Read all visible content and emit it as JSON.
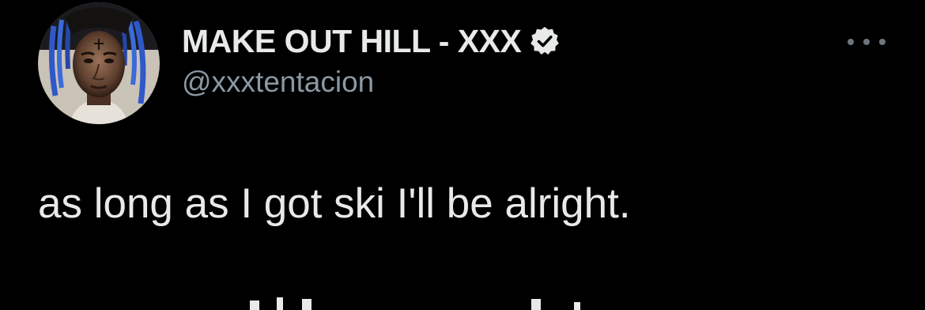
{
  "author": {
    "display_name": "MAKE OUT HILL - XXX",
    "handle": "@xxxtentacion",
    "verified": true
  },
  "tweet": {
    "text": "as long as I got ski I'll be alright."
  },
  "icons": {
    "avatar": "profile-avatar",
    "verified": "verified-badge-icon",
    "more": "more-options-icon"
  },
  "colors": {
    "background": "#000000",
    "primary_text": "#e7e9ea",
    "secondary_text": "#8b98a5",
    "icon_gray": "#6e767d"
  }
}
